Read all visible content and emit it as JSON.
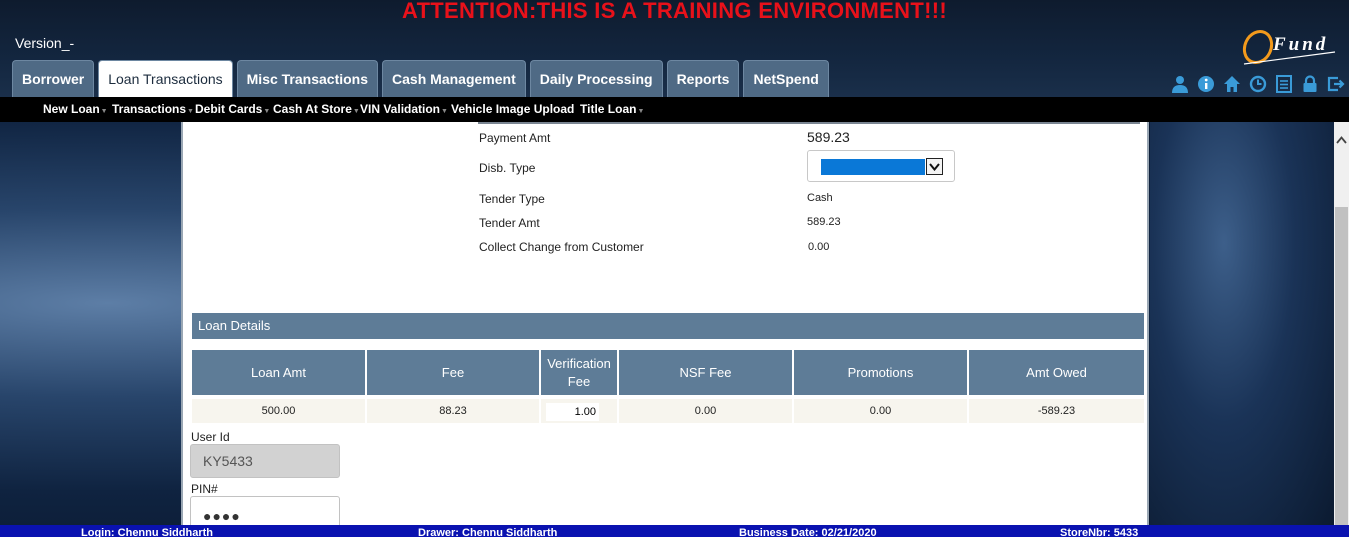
{
  "banner": "ATTENTION:THIS IS A TRAINING ENVIRONMENT!!!",
  "version": "Version_-",
  "logo_text": "Fund",
  "tabs": [
    {
      "label": "Borrower"
    },
    {
      "label": "Loan Transactions"
    },
    {
      "label": "Misc Transactions"
    },
    {
      "label": "Cash Management"
    },
    {
      "label": "Daily Processing"
    },
    {
      "label": "Reports"
    },
    {
      "label": "NetSpend"
    }
  ],
  "active_tab": "Loan Transactions",
  "submenu": [
    {
      "label": "New Loan"
    },
    {
      "label": "Transactions"
    },
    {
      "label": "Debit Cards"
    },
    {
      "label": "Cash At Store"
    },
    {
      "label": "VIN Validation"
    },
    {
      "label": "Vehicle Image Upload"
    },
    {
      "label": "Title Loan"
    }
  ],
  "header_icons": [
    "user-icon",
    "info-icon",
    "home-icon",
    "clock-icon",
    "list-icon",
    "lock-icon",
    "logout-icon"
  ],
  "form": {
    "payment_amt_label": "Payment Amt",
    "payment_amt_value": "589.23",
    "disb_type_label": "Disb. Type",
    "tender_type_label": "Tender Type",
    "tender_type_value": "Cash",
    "tender_amt_label": "Tender Amt",
    "tender_amt_value": "589.23",
    "collect_change_label": "Collect Change from Customer",
    "collect_change_value": "0.00"
  },
  "loan_details": {
    "title": "Loan Details",
    "headers": [
      "Loan Amt",
      "Fee",
      "Verification Fee",
      "NSF Fee",
      "Promotions",
      "Amt Owed"
    ],
    "row": [
      "500.00",
      "88.23",
      "1.00",
      "0.00",
      "0.00",
      "-589.23"
    ]
  },
  "auth": {
    "user_id_label": "User Id",
    "user_id_value": "KY5433",
    "pin_label": "PIN#",
    "pin_value": "●●●●"
  },
  "status": {
    "login": "Login: Chennu Siddharth",
    "drawer": "Drawer: Chennu Siddharth",
    "business_date": "Business Date: 02/21/2020",
    "store": "StoreNbr: 5433"
  },
  "colors": {
    "banner": "#e8111a",
    "tab_bg": "#4f6a85",
    "section_bg": "#5e7c97",
    "status_bar": "#0a12b0",
    "select_fill": "#0a78d7"
  }
}
